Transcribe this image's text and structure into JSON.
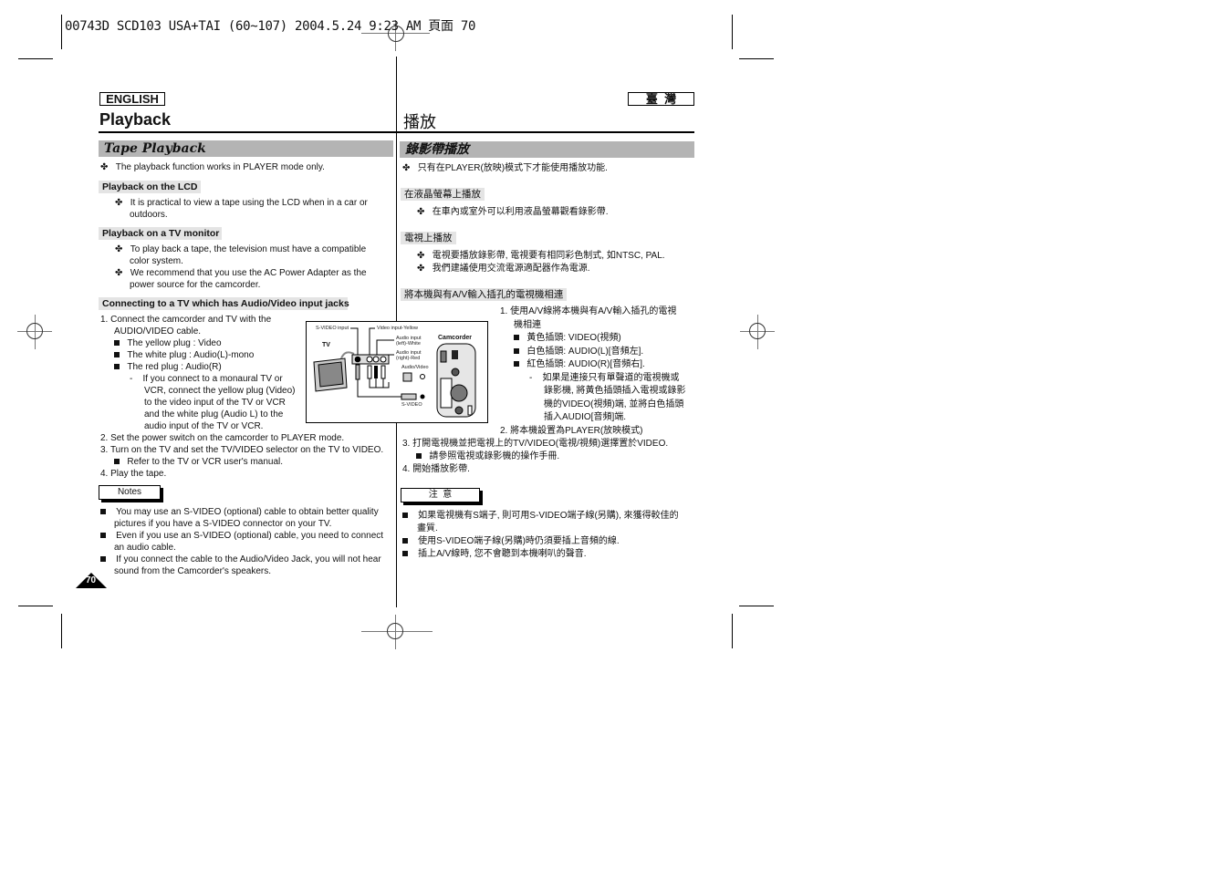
{
  "print_header": {
    "text": "00743D SCD103 USA+TAI (60~107) 2004.5.24 9:23 AM 頁面 70"
  },
  "english": {
    "lang_label": "ENGLISH",
    "page_title": "Playback",
    "section_title": "Tape Playback",
    "intro": "The playback function works in PLAYER mode only.",
    "lcd": {
      "heading": "Playback on the LCD",
      "bullets": [
        "It is practical to view a tape using the LCD when in a car or",
        "outdoors."
      ]
    },
    "tv": {
      "heading": "Playback on a TV monitor",
      "bullets": [
        [
          "To play back a tape, the television must have a compatible",
          "color system."
        ],
        [
          "We recommend that you use the AC Power Adapter as the",
          "power source for the camcorder."
        ]
      ]
    },
    "connect": {
      "heading": "Connecting to a TV which has Audio/Video input jacks",
      "step1": [
        "1.  Connect the camcorder and TV with the",
        "AUDIO/VIDEO cable."
      ],
      "plugs": [
        "The yellow plug : Video",
        "The white plug : Audio(L)-mono",
        "The red plug : Audio(R)"
      ],
      "mono_note": [
        "If you connect to a monaural TV or",
        "VCR, connect the yellow plug (Video)",
        "to the video input of the TV or VCR",
        "and the white plug (Audio L) to the",
        "audio input of the TV or VCR."
      ],
      "step2": "2.  Set the power switch on the camcorder to PLAYER mode.",
      "step3": "3.  Turn on the TV and set the TV/VIDEO selector on the TV to VIDEO.",
      "step3_sub": "Refer to the TV or VCR user's manual.",
      "step4": "4.  Play the tape."
    },
    "notes": {
      "label": "Notes",
      "items": [
        [
          "You may use an S-VIDEO (optional) cable to obtain better quality",
          "pictures if you have a S-VIDEO connector on your TV."
        ],
        [
          "Even if you use an S-VIDEO (optional) cable, you need to connect",
          "an audio cable."
        ],
        [
          "If you connect the cable to the Audio/Video Jack, you will not hear",
          "sound from the Camcorder's speakers."
        ]
      ]
    },
    "page_number": "70"
  },
  "diagram": {
    "tv_label": "TV",
    "camcorder_label": "Camcorder",
    "svideo_input": "S-VIDEO input",
    "video_input": "Video input-Yellow",
    "audio_left": [
      "Audio input",
      "(left)-White"
    ],
    "audio_right": [
      "Audio input",
      "(right)-Red"
    ],
    "audio_video": "Audio/Video",
    "svideo": "S-VIDEO"
  },
  "chinese": {
    "lang_label": "臺  灣",
    "page_title": "播放",
    "section_title": "錄影帶播放",
    "intro": "只有在PLAYER(放映)模式下才能使用播放功能.",
    "lcd": {
      "heading": "在液晶螢幕上播放",
      "bullet": "在車內或室外可以利用液晶螢幕觀看錄影帶."
    },
    "tv": {
      "heading": "電視上播放",
      "bullets": [
        "電視要播放錄影帶, 電視要有相同彩色制式, 如NTSC, PAL.",
        "我們建議使用交流電源適配器作為電源."
      ]
    },
    "connect": {
      "heading": "將本機與有A/V輸入插孔的電視機相連",
      "step1": [
        "1.  使用A/V線將本機與有A/V輸入插孔的電視",
        "機相連"
      ],
      "plugs": [
        "黃色插頭: VIDEO(視頻)",
        "白色插頭: AUDIO(L)[音頻左].",
        "紅色插頭: AUDIO(R)[音頻右]."
      ],
      "mono_note": [
        "如果是連接只有單聲道的電視機或",
        "錄影機, 將黃色插頭插入電視或錄影",
        "機的VIDEO(視頻)端, 並將白色插頭",
        "插入AUDIO[音頻]端."
      ],
      "step2": "2.  將本機設置為PLAYER(放映模式)",
      "step3": "3.  打開電視機並把電視上的TV/VIDEO(電視/視頻)選擇置於VIDEO.",
      "step3_sub": "請參照電視或錄影機的操作手冊.",
      "step4": "4.  開始播放影帶."
    },
    "notes": {
      "label": "注  意",
      "items": [
        [
          "如果電視機有S端子, 則可用S-VIDEO端子線(另購), 來獲得較佳的",
          "畫質."
        ],
        [
          "使用S-VIDEO端子線(另購)時仍須要插上音頻的線."
        ],
        [
          "插上A/V線時, 您不會聽到本機喇叭的聲音."
        ]
      ]
    }
  }
}
